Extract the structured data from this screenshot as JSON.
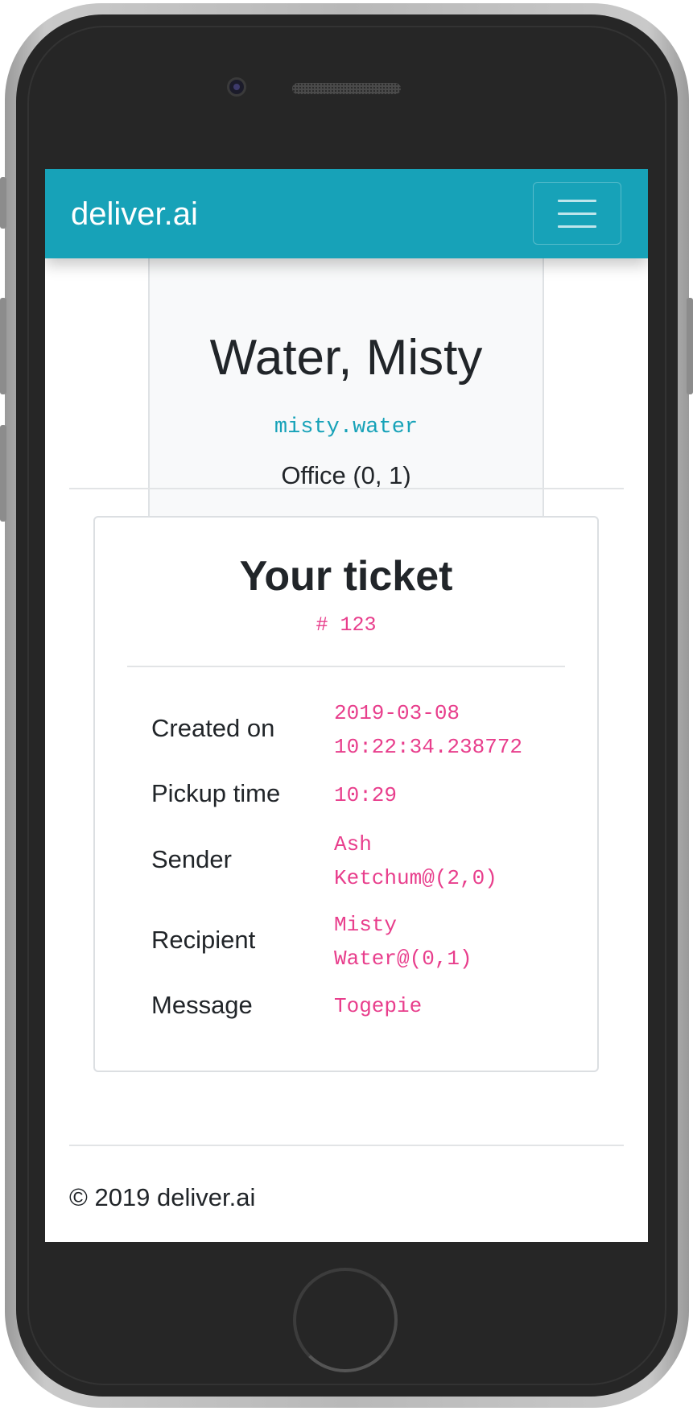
{
  "navbar": {
    "brand": "deliver.ai",
    "toggler_icon": "hamburger-icon"
  },
  "profile": {
    "name": "Water, Misty",
    "username": "misty.water",
    "location": "Office (0, 1)"
  },
  "ticket": {
    "title": "Your ticket",
    "number": "# 123",
    "rows": [
      {
        "label": "Created on",
        "value": "2019-03-08\n10:22:34.238772"
      },
      {
        "label": "Pickup time",
        "value": "10:29"
      },
      {
        "label": "Sender",
        "value": "Ash\nKetchum@(2,0)"
      },
      {
        "label": "Recipient",
        "value": "Misty\nWater@(0,1)"
      },
      {
        "label": "Message",
        "value": "Togepie"
      }
    ]
  },
  "footer": {
    "copyright": "© 2019 deliver.ai"
  },
  "colors": {
    "brand": "#17a2b8",
    "code": "#e83e8c",
    "text": "#212529",
    "card_bg": "#f8f9fa"
  }
}
